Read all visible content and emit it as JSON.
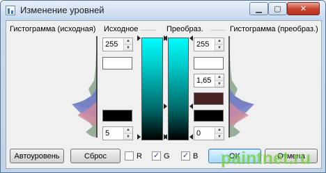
{
  "window": {
    "title": "Изменение уровней",
    "controls": {
      "minimize": "▁",
      "maximize": "▢",
      "close": "✕"
    }
  },
  "labels": {
    "histogram_source": "Гистограмма (исходная)",
    "source": "Исходное",
    "transformed": "Преобраз.",
    "histogram_transformed": "Гистограмма (преобраз.)"
  },
  "inputs": {
    "source_white": "255",
    "source_black": "5",
    "output_white": "255",
    "gamma": "1,65",
    "output_black": "0"
  },
  "colors": {
    "source_white_swatch": "#ffffff",
    "source_black_swatch": "#000000",
    "output_white_swatch": "#ffffff",
    "gamma_swatch": "#4a2424",
    "output_black_swatch": "#000000",
    "gradient_top": "#00ffff",
    "gradient_bottom": "#000000"
  },
  "buttons": {
    "auto_level": "Автоуровень",
    "reset": "Сброс",
    "ok": "OK",
    "cancel": "Отмена"
  },
  "channels": [
    {
      "label": "R",
      "checked": false
    },
    {
      "label": "G",
      "checked": true
    },
    {
      "label": "B",
      "checked": true
    }
  ],
  "watermark": "paintnet.ru"
}
